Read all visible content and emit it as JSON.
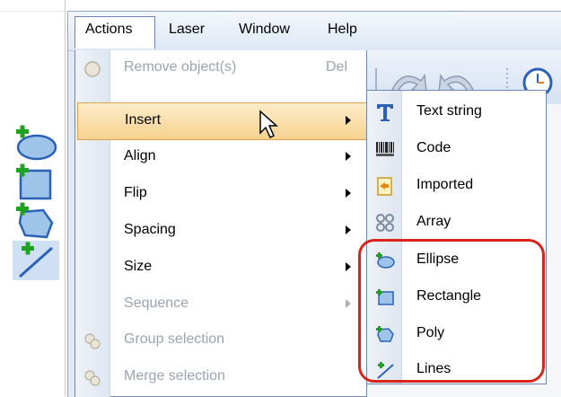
{
  "menubar": {
    "items": [
      {
        "label": "Actions"
      },
      {
        "label": "Laser"
      },
      {
        "label": "Window"
      },
      {
        "label": "Help"
      }
    ]
  },
  "actions_menu": {
    "items": [
      {
        "label": "Remove object(s)",
        "shortcut": "Del",
        "enabled": false
      },
      {
        "label": "Insert",
        "submenu": true,
        "highlighted": true
      },
      {
        "label": "Align",
        "submenu": true
      },
      {
        "label": "Flip",
        "submenu": true
      },
      {
        "label": "Spacing",
        "submenu": true
      },
      {
        "label": "Size",
        "submenu": true
      },
      {
        "label": "Sequence",
        "submenu": true,
        "enabled": false
      },
      {
        "label": "Group selection",
        "enabled": false
      },
      {
        "label": "Merge selection",
        "enabled": false
      }
    ]
  },
  "insert_submenu": {
    "items": [
      {
        "label": "Text string",
        "icon": "text-icon"
      },
      {
        "label": "Code",
        "icon": "barcode-icon"
      },
      {
        "label": "Imported",
        "icon": "import-icon"
      },
      {
        "label": "Array",
        "icon": "array-icon"
      },
      {
        "label": "Ellipse",
        "icon": "ellipse-icon"
      },
      {
        "label": "Rectangle",
        "icon": "rectangle-icon"
      },
      {
        "label": "Poly",
        "icon": "poly-icon"
      },
      {
        "label": "Lines",
        "icon": "lines-icon"
      }
    ]
  },
  "left_column_icons": [
    "add-ellipse-icon",
    "add-rectangle-icon",
    "add-poly-icon",
    "add-line-icon"
  ],
  "colors": {
    "highlight_border": "#d9241c",
    "menu_highlight": "#f7d291",
    "menubar_bg": "#dde7f5"
  }
}
